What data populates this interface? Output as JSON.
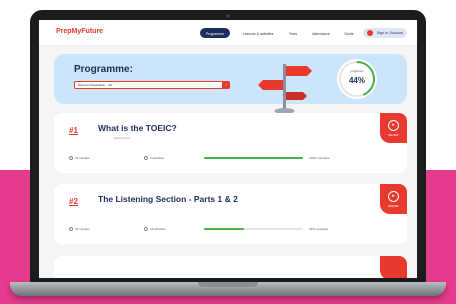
{
  "colors": {
    "brand": "#e8392e",
    "navy": "#1f2d5c",
    "hero": "#cde5fa",
    "band": "#e43a8b",
    "progress": "#47b34a"
  },
  "nav": {
    "logo": "PrepMyFuture",
    "tabs": [
      "Programme",
      "Lessons & activities",
      "Tests",
      "Attendance",
      "Guide"
    ],
    "account_button": "Sign in / Account"
  },
  "hero": {
    "title": "Programme:",
    "select_value": "Express Preparation – 3H",
    "gauge_label": "programme",
    "gauge_value": "44%",
    "gauge_fraction": 0.44
  },
  "cards": [
    {
      "num": "#1",
      "title": "What is the TOEIC?",
      "subtitle": "lesson for test",
      "duration": "24 minutes",
      "lessons": "3 activities",
      "progress": 1.0,
      "progress_label": "100% complete",
      "action": "REVIEW"
    },
    {
      "num": "#2",
      "title": "The Listening Section - Parts 1 & 2",
      "subtitle": "",
      "duration": "75 minutes",
      "lessons": "16 activities",
      "progress": 0.4,
      "progress_label": "40% complete",
      "action": "RESUME"
    }
  ]
}
